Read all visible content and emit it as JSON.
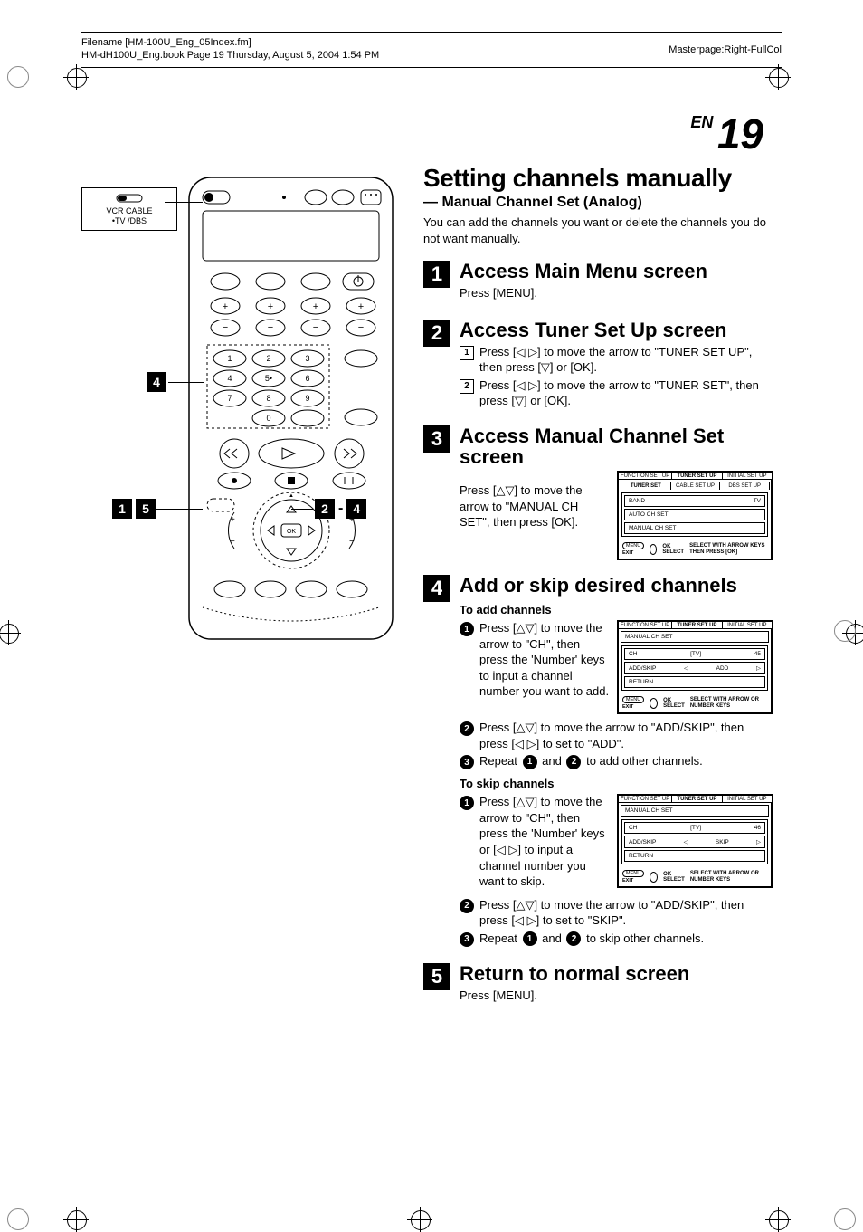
{
  "header": {
    "filename_label": "Filename [HM-100U_Eng_05Index.fm]",
    "bookinfo": "HM-dH100U_Eng.book  Page 19  Thursday, August 5, 2004  1:54 PM",
    "masterpage": "Masterpage:Right-FullCol"
  },
  "page": {
    "lang": "EN",
    "number": "19"
  },
  "remote": {
    "callout_top": "VCR   CABLE",
    "callout_bottom": "•TV   /DBS",
    "step4_badge": "4",
    "step15_a": "1",
    "step15_b": "5",
    "step24_a": "2",
    "step24_b": "4",
    "step24_dash": "-"
  },
  "section": {
    "title": "Setting channels manually",
    "subtitle": "— Manual Channel Set (Analog)",
    "intro": "You can add the channels you want or delete the channels you do not want manually."
  },
  "steps": {
    "s1": {
      "n": "1",
      "h": "Access Main Menu screen",
      "p": "Press [MENU]."
    },
    "s2": {
      "n": "2",
      "h": "Access Tuner Set Up screen",
      "sub1_n": "1",
      "sub1": "Press [◁ ▷] to move the arrow to \"TUNER SET UP\", then press [▽] or [OK].",
      "sub2_n": "2",
      "sub2": "Press [◁ ▷] to move the arrow to \"TUNER SET\", then press [▽] or [OK]."
    },
    "s3": {
      "n": "3",
      "h": "Access Manual Channel Set screen",
      "p": "Press [△▽] to move the arrow to \"MANUAL CH SET\", then press [OK]."
    },
    "s4": {
      "n": "4",
      "h": "Add or skip desired channels",
      "add_label": "To add channels",
      "add1_n": "1",
      "add1": "Press [△▽] to move the arrow to \"CH\", then press the 'Number' keys to input a channel number you want to add.",
      "add2_n": "2",
      "add2": "Press [△▽] to move the arrow to \"ADD/SKIP\", then press [◁ ▷] to set to \"ADD\".",
      "add3_n": "3",
      "add3_a": "Repeat ",
      "add3_b": " and ",
      "add3_c": " to add other channels.",
      "skip_label": "To skip channels",
      "skip1_n": "1",
      "skip1": "Press [△▽] to move the arrow to \"CH\", then press the 'Number' keys or [◁ ▷] to input a channel number you want to skip.",
      "skip2_n": "2",
      "skip2": "Press [△▽] to move the arrow to \"ADD/SKIP\", then press [◁ ▷] to set to \"SKIP\".",
      "skip3_n": "3",
      "skip3_a": "Repeat ",
      "skip3_b": " and ",
      "skip3_c": " to skip other channels."
    },
    "s5": {
      "n": "5",
      "h": "Return to normal screen",
      "p": "Press [MENU]."
    }
  },
  "osd1": {
    "tabs": [
      "FUNCTION SET UP",
      "TUNER SET UP",
      "INITIAL SET UP"
    ],
    "tabs2": [
      "TUNER SET",
      "CABLE SET UP",
      "DBS SET UP"
    ],
    "rows": [
      {
        "l": "BAND",
        "r": "TV"
      },
      {
        "l": "AUTO CH SET",
        "r": ""
      },
      {
        "l": "MANUAL CH SET",
        "r": ""
      }
    ],
    "footer_menu": "MENU",
    "footer_exit": "EXIT",
    "footer_ok": "OK",
    "footer_select": "SELECT",
    "footer_instr": "SELECT WITH ARROW KEYS THEN PRESS [OK]"
  },
  "osd2": {
    "tabs": [
      "FUNCTION SET UP",
      "TUNER SET UP",
      "INITIAL SET UP"
    ],
    "crumb": "MANUAL CH SET",
    "rows": [
      {
        "l": "CH",
        "m": "[TV]",
        "r": "45"
      },
      {
        "l": "ADD/SKIP",
        "m": "◁",
        "r": "ADD",
        "r2": "▷"
      },
      {
        "l": "RETURN"
      }
    ],
    "footer_menu": "MENU",
    "footer_exit": "EXIT",
    "footer_ok": "OK",
    "footer_select": "SELECT",
    "footer_instr": "SELECT WITH ARROW OR NUMBER KEYS"
  },
  "osd3": {
    "tabs": [
      "FUNCTION SET UP",
      "TUNER SET UP",
      "INITIAL SET UP"
    ],
    "crumb": "MANUAL CH SET",
    "rows": [
      {
        "l": "CH",
        "m": "[TV]",
        "r": "46"
      },
      {
        "l": "ADD/SKIP",
        "m": "◁",
        "r": "SKIP",
        "r2": "▷"
      },
      {
        "l": "RETURN"
      }
    ],
    "footer_menu": "MENU",
    "footer_exit": "EXIT",
    "footer_ok": "OK",
    "footer_select": "SELECT",
    "footer_instr": "SELECT WITH ARROW OR NUMBER KEYS"
  }
}
